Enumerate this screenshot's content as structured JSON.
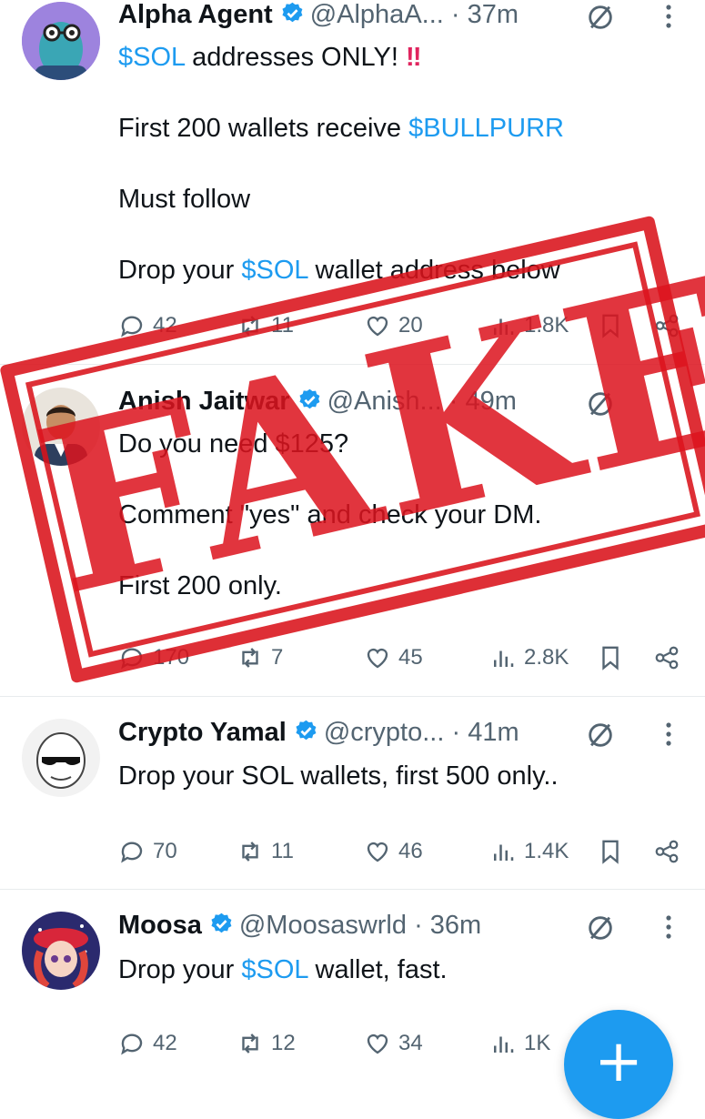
{
  "tweets": [
    {
      "name": "Alpha Agent",
      "handle": "@AlphaA...",
      "separator": "·",
      "time": "37m",
      "lines": [
        {
          "parts": [
            {
              "text": "$SOL",
              "link": true
            },
            {
              "text": " addresses ONLY! "
            },
            {
              "text": "‼",
              "bang": true
            }
          ]
        },
        {
          "parts": [
            {
              "text": "First 200 wallets receive "
            },
            {
              "text": "$BULLPURR",
              "link": true
            }
          ]
        },
        {
          "parts": [
            {
              "text": "Must follow"
            }
          ]
        },
        {
          "parts": [
            {
              "text": "Drop your "
            },
            {
              "text": "$SOL",
              "link": true
            },
            {
              "text": " wallet address below"
            }
          ]
        }
      ],
      "replies": "42",
      "reposts": "11",
      "likes": "20",
      "views": "1.8K"
    },
    {
      "name": "Anish Jaitwar",
      "handle": "@Anish...",
      "separator": "·",
      "time": "49m",
      "lines": [
        {
          "parts": [
            {
              "text": "Do you need $125?"
            }
          ]
        },
        {
          "parts": [
            {
              "text": "Comment \"yes\" and check your DM."
            }
          ]
        },
        {
          "parts": [
            {
              "text": "First 200 only."
            }
          ]
        }
      ],
      "replies": "170",
      "reposts": "7",
      "likes": "45",
      "views": "2.8K"
    },
    {
      "name": "Crypto Yamal",
      "handle": "@crypto...",
      "separator": "·",
      "time": "41m",
      "lines": [
        {
          "parts": [
            {
              "text": "Drop your SOL wallets, first 500 only.."
            }
          ]
        }
      ],
      "replies": "70",
      "reposts": "11",
      "likes": "46",
      "views": "1.4K"
    },
    {
      "name": "Moosa",
      "handle": "@Moosaswrld",
      "separator": "·",
      "time": "36m",
      "lines": [
        {
          "parts": [
            {
              "text": "Drop your "
            },
            {
              "text": "$SOL",
              "link": true
            },
            {
              "text": " wallet, fast."
            }
          ]
        }
      ],
      "replies": "42",
      "reposts": "12",
      "likes": "34",
      "views": "1K"
    }
  ],
  "stamp": {
    "text": "FAKE",
    "color": "#da121a"
  },
  "fab": {
    "symbol": "+"
  },
  "colors": {
    "accent": "#1d9bf0",
    "text": "#0f1419",
    "muted": "#536471"
  },
  "icons": [
    "reply-icon",
    "repost-icon",
    "like-icon",
    "views-icon",
    "bookmark-icon",
    "share-icon",
    "grok-icon",
    "more-icon",
    "verified-badge-icon"
  ]
}
